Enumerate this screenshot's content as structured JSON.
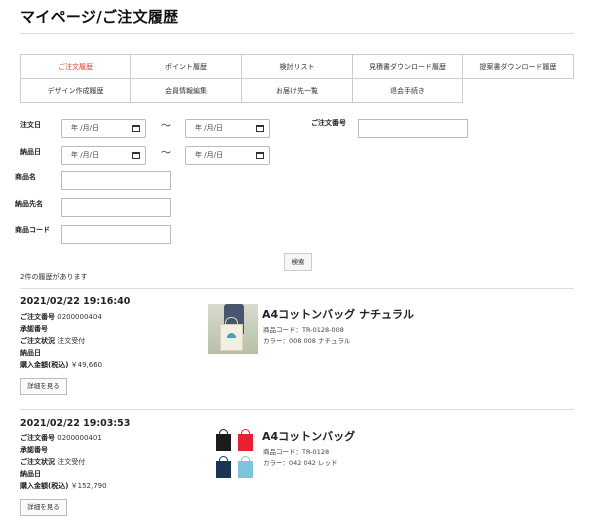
{
  "page": {
    "title": "マイページ/ご注文履歴"
  },
  "tabs": [
    {
      "label": "ご注文履歴",
      "active": true
    },
    {
      "label": "ポイント履歴"
    },
    {
      "label": "検討リスト"
    },
    {
      "label": "見積書ダウンロード履歴"
    },
    {
      "label": "提案書ダウンロード履歴"
    },
    {
      "label": "デザイン作成履歴"
    },
    {
      "label": "会員情報編集"
    },
    {
      "label": "お届け先一覧"
    },
    {
      "label": "退会手続き"
    }
  ],
  "search": {
    "order_date_label": "注文日",
    "delivery_date_label": "納品日",
    "order_no_label": "ご注文番号",
    "product_name_label": "商品名",
    "ship_to_label": "納品先名",
    "product_code_label": "商品コード",
    "date_placeholder": "年 /月/日",
    "range_sep": "〜",
    "button_label": "検索"
  },
  "results": {
    "count_text": "2件の履歴があります"
  },
  "labels": {
    "order_no": "ご注文番号",
    "approval_no": "承認番号",
    "status": "ご注文状況",
    "delivery_date": "納品日",
    "total": "購入金額(税込)",
    "detail_button": "詳細を見る"
  },
  "orders": [
    {
      "datetime": "2021/02/22 19:16:40",
      "order_no": "0200000404",
      "status": "注文受付",
      "total": "￥49,660",
      "product_name": "A4コットンバッグ ナチュラル",
      "product_code": "商品コード：TR-0128-008",
      "color": "カラー：008 008 ナチュラル",
      "image_icon": "tote-bag-photo-icon"
    },
    {
      "datetime": "2021/02/22 19:03:53",
      "order_no": "0200000401",
      "status": "注文受付",
      "total": "￥152,790",
      "product_name": "A4コットンバッグ",
      "product_code": "商品コード：TR-0128",
      "color": "カラー：042 042 レッド",
      "image_icon": "tote-bag-colors-icon",
      "swatches": [
        "#1c1c1c",
        "#e8202f",
        "#1c3554",
        "#7ac4dc"
      ]
    }
  ],
  "colors": {
    "active_tab": "#d0453a",
    "border": "#cccccc"
  }
}
